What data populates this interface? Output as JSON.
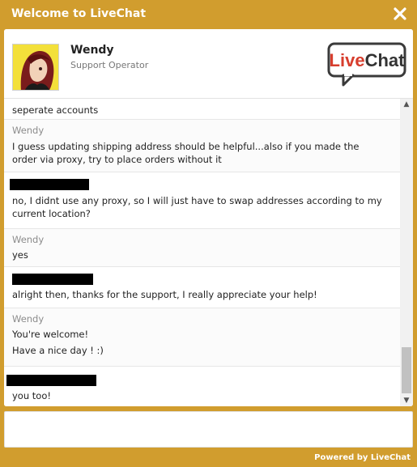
{
  "window": {
    "title": "Welcome to LiveChat",
    "close_icon": "close-icon"
  },
  "agent": {
    "name": "Wendy",
    "role": "Support Operator",
    "avatar_icon": "agent-avatar"
  },
  "logo": {
    "text_live": "Live",
    "text_chat": "Chat",
    "colors": {
      "live": "#d73d2d",
      "chat": "#333333",
      "bubble_border": "#3a3a3a"
    }
  },
  "messages": [
    {
      "author": "",
      "redacted": false,
      "lines": [
        "seperate accounts"
      ]
    },
    {
      "author": "Wendy",
      "redacted": false,
      "lines": [
        "I guess updating shipping address should be helpful...also if you made the",
        "order via proxy, try to place orders without it"
      ]
    },
    {
      "author": "",
      "redacted": true,
      "lines": [
        "no, I didnt use any proxy, so I will just have to swap addresses according to my",
        "current location?"
      ]
    },
    {
      "author": "Wendy",
      "redacted": false,
      "lines": [
        "yes"
      ]
    },
    {
      "author": "",
      "redacted": true,
      "lines": [
        "alright then, thanks for the support, I really appreciate your help!"
      ]
    },
    {
      "author": "Wendy",
      "redacted": false,
      "lines": [
        "You're welcome!",
        "Have a nice day ! :)"
      ]
    },
    {
      "author": "",
      "redacted": true,
      "lines": [
        "you too!"
      ]
    }
  ],
  "input": {
    "placeholder": "",
    "value": ""
  },
  "footer": {
    "powered_by": "Powered by LiveChat"
  },
  "colors": {
    "accent": "#d19d2e",
    "panel": "#ffffff",
    "author": "#8c8c8c",
    "text": "#222222"
  }
}
